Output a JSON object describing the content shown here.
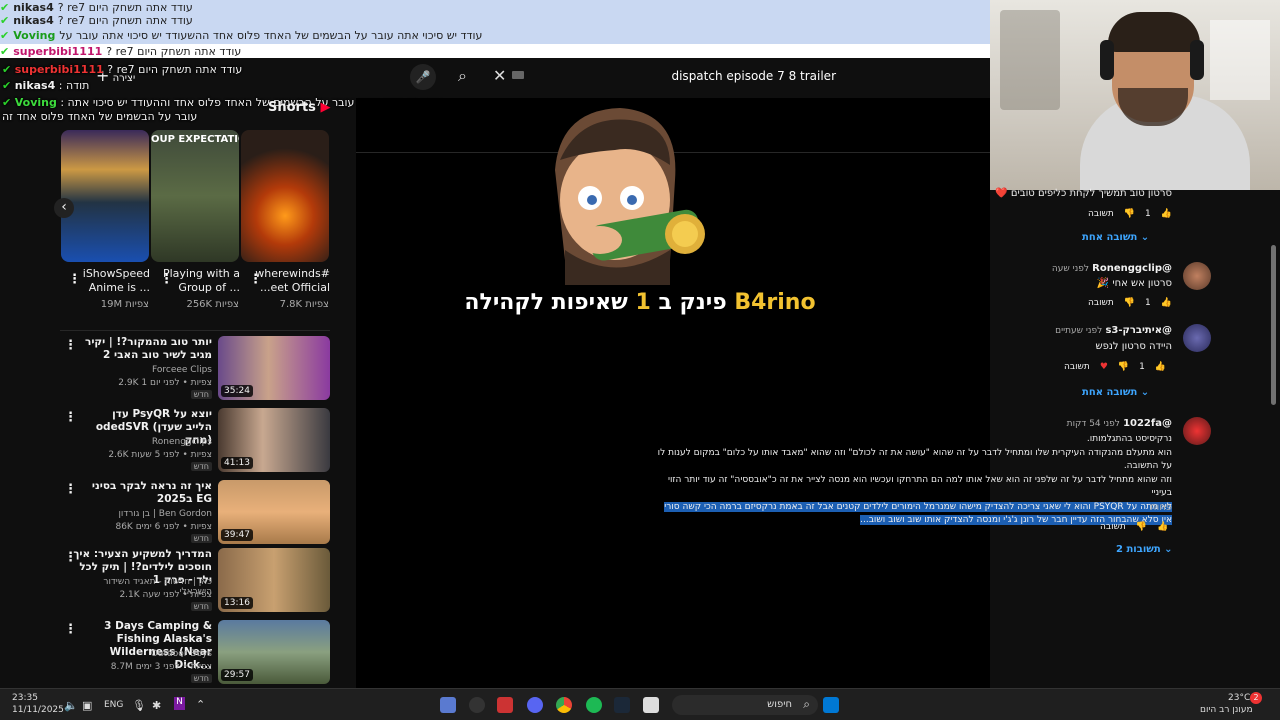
{
  "chat_top": [
    {
      "user": "nikas4",
      "text": "? re7 עודד אתה תשחק היום"
    },
    {
      "user": "nikas4",
      "text": "? re7 עודד אתה תשחק היום"
    },
    {
      "user": "Voving",
      "text": "עודד יש סיכוי אתה עובר על הבשמים של האחד פלוס אחד ההשעודד יש סיכוי אתה עובר על"
    },
    {
      "user": "superbibi1111",
      "text": "? re7 עודד אתה תשחק היום"
    }
  ],
  "chat_left": [
    {
      "user": "superbibi1111",
      "text": "? re7 עודד אתה תשחק היום"
    },
    {
      "user": "nikas4",
      "text": "תודה"
    },
    {
      "user": "Voving",
      "text": "עודד יש סיכוי אתה עובר על הבשמים של האחד פלוס אחד וההעודד יש סיכוי אתה"
    },
    {
      "user": "",
      "text": "עובר על הבשמים של האחד פלוס אחד זה"
    }
  ],
  "header": {
    "search_query": "dispatch episode 7 8 trailer",
    "create_label": "יצירה"
  },
  "shorts": {
    "title": "Shorts",
    "items": [
      {
        "title": "iShowSpeed Anime is ...",
        "views": "19M צפיות",
        "thumb_text": ""
      },
      {
        "title": "Playing with a Group of ...",
        "views": "256K צפיות",
        "thumb_text": "OUP EXPECTATIO"
      },
      {
        "title": "wherewinds# ...eet Official",
        "views": "7.8K צפיות",
        "thumb_text": ""
      }
    ]
  },
  "videos": [
    {
      "title": "יותר טוב מהמקור?! | יקיר מגיב לשיר טוב האבי 2",
      "channel": "Forceee Clips",
      "meta": "2.9K צפיות • לפני יום 1",
      "badge": "חדש",
      "duration": "35:24"
    },
    {
      "title": "עדן PsyQR יוצא על odedSVR (הלייב שעדן מחק)",
      "channel": "Ronenggclips",
      "meta": "2.6K צפיות • לפני 5 שעות",
      "badge": "חדש",
      "duration": "41:13"
    },
    {
      "title": "איך זה נראה לבקר בסיני ב2025 EG",
      "channel": "בן גורדון | Ben Gordon",
      "meta": "86K צפיות • לפני 6 ימים",
      "badge": "חדש",
      "duration": "39:47"
    },
    {
      "title": "המדריך למשקיע הצעיר: איך חוסכים לילדים?! | תיק לכל ילד - פרק 1",
      "channel": "כאן | חדשות - תאגיד השידור הישראלי",
      "meta": "2.1K צפיות • לפני שעה",
      "badge": "חדש",
      "duration": "13:16"
    },
    {
      "title": "3 Days Camping & Fishing Alaska's Wilderness (Near Dick...",
      "channel": "Outdoor Boys",
      "meta": "8.7M צפיות • לפני 3 ימים",
      "badge": "חדש",
      "duration": "29:57"
    }
  ],
  "stream": {
    "name": "B4rino",
    "pre": "פינק ב",
    "num": "1",
    "post": "שאיפות לקהילה"
  },
  "comments": [
    {
      "text": "סרטון טוב תמשיך לקחת כליפים טובים ❤️",
      "likes": "1",
      "reply": "תשובה",
      "replies": "תשובה אחת"
    },
    {
      "author": "@Ronenggclip",
      "time": "לפני שעה",
      "text": "סרטון אש אחי 🎉",
      "likes": "1",
      "reply": "תשובה"
    },
    {
      "author": "@איתיברק-s3",
      "time": "לפני שעתיים",
      "text": "היידה סרטון לנפש",
      "likes": "1",
      "reply": "תשובה",
      "replies": "תשובה אחת"
    },
    {
      "author": "@1022fa",
      "time": "לפני 54 דקות",
      "lines": [
        "נרקיסיסט בהתגלמותו.",
        "הוא מתעלם מהנקודה העיקרית שלו ומתחיל לדבר על זה שהוא \"עושה את זה לכולם\" וזה שהוא \"מאבד אותו על כלום\" במקום לענות לו על התשובה.",
        "וזה שהוא מתחיל לדבר על זה שלפני זה הוא שאל אותו למה הם התרחקו ועכשיו הוא מנסה לצייר את זה כ\"אובססיה\" זה עוד יותר הזוי בעיניי",
        "לא מתה על PSYQR והוא לי שאני צריכה להצדיק מישהו שמנרמל הימורים לילדים קטנים אבל זה באמת נרקסיזם ברמה הכי קשה סורי",
        "אין סלא שהבחור הזה עדיין חבר של רונן ג'ג'י ומנסה להצדיק אותו שוב ושוב ושוב..."
      ],
      "less": "פחות",
      "reply": "תשובה",
      "replies": "2 תשובות"
    }
  ],
  "taskbar": {
    "time": "23:35",
    "date": "11/11/2025",
    "lang": "ENG",
    "search": "חיפוש",
    "weather_temp": "23°C",
    "weather_desc": "מעונן רב היום",
    "notif": "2"
  }
}
